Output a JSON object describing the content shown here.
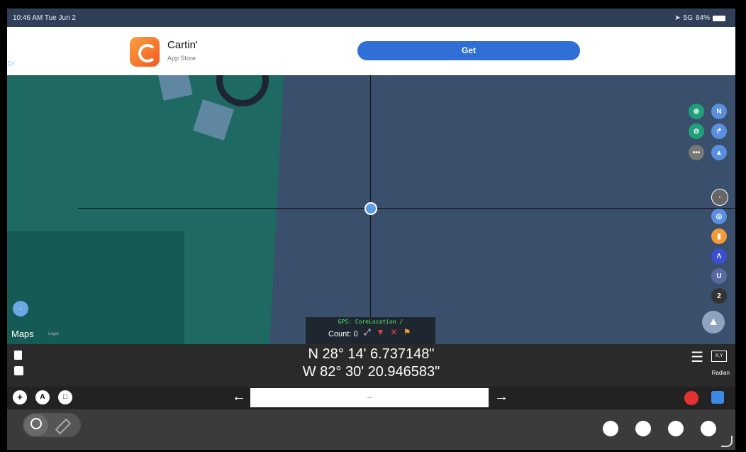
{
  "status_bar": {
    "time": "10:46 AM",
    "date": "Tue Jun 2",
    "signal": "5G",
    "battery": "84%"
  },
  "ad": {
    "app_name": "Cartin'",
    "store": "App Store",
    "button": "Get"
  },
  "map": {
    "legal": "Maps",
    "gps_source": "GPS: CoreLocation /",
    "count_label": "Count: 0",
    "side_number": "2"
  },
  "coordinates": {
    "latitude": "N 28° 14' 6.737148\"",
    "longitude": "W 82° 30' 20.946583\"",
    "unit": "Radian",
    "xy_label": "X,Y"
  },
  "input_bar": {
    "value": "--"
  }
}
